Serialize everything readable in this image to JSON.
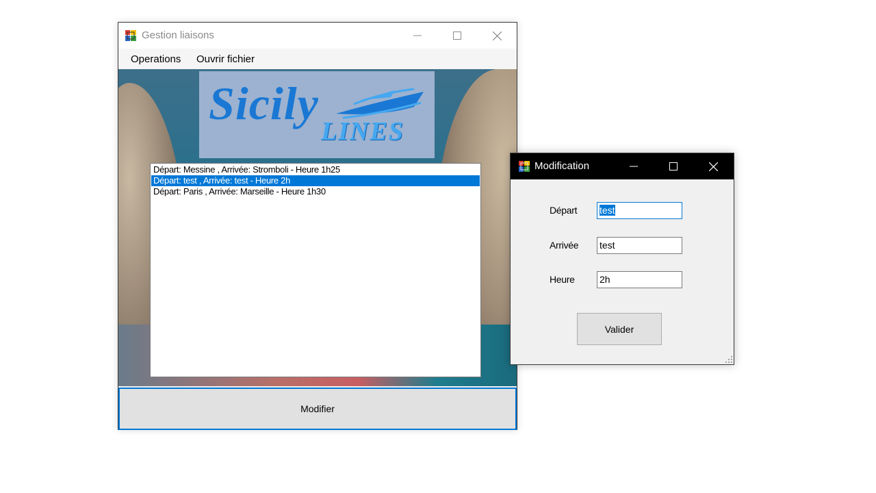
{
  "main_window": {
    "title": "Gestion liaisons",
    "menu": [
      "Operations",
      "Ouvrir fichier"
    ],
    "logo": {
      "main": "Sicily",
      "sub": "LINES"
    },
    "list_items": [
      "Départ: Messine , Arrivée: Stromboli - Heure 1h25",
      "Départ: test , Arrivée: test - Heure 2h",
      "Départ: Paris , Arrivée: Marseille - Heure 1h30"
    ],
    "selected_index": 1,
    "modify_button": "Modifier"
  },
  "dialog": {
    "title": "Modification",
    "fields": [
      {
        "label": "Départ",
        "value": "test"
      },
      {
        "label": "Arrivée",
        "value": "test"
      },
      {
        "label": "Heure",
        "value": "2h"
      }
    ],
    "submit_button": "Valider"
  },
  "colors": {
    "accent": "#0078d7",
    "dialog_titlebar": "#000000",
    "logo_bg": "#9cb2d0",
    "logo_text": "#1a78d4"
  },
  "icons": [
    "app-icon",
    "minimize-icon",
    "maximize-icon",
    "close-icon",
    "resize-grip-icon"
  ]
}
